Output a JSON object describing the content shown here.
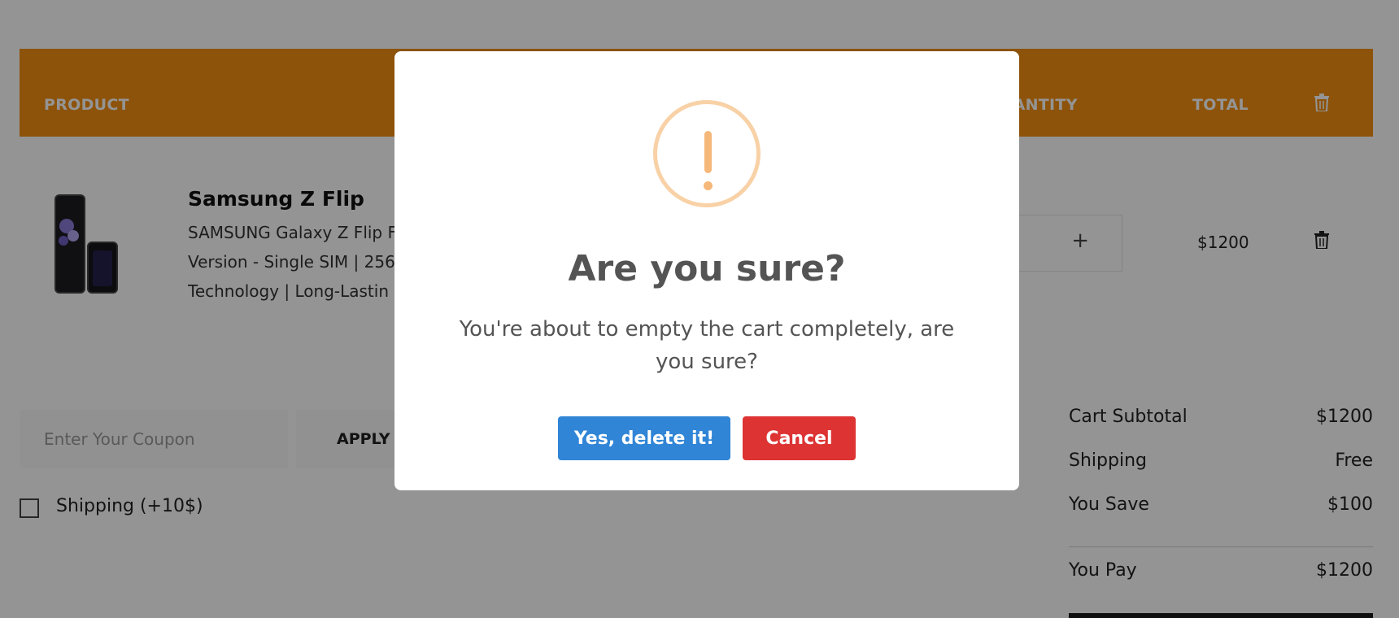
{
  "cart": {
    "headers": {
      "product": "PRODUCT",
      "quantity": "QUANTITY",
      "total": "TOTAL"
    },
    "items": [
      {
        "name": "Samsung Z Flip",
        "description": "SAMSUNG Galaxy Z Flip F\nVersion - Single SIM | 256\nTechnology | Long-Lastin",
        "total": "$1200"
      }
    ],
    "qty_plus": "+"
  },
  "coupon": {
    "placeholder": "Enter Your Coupon",
    "apply_label": "APPLY"
  },
  "shipping_option": {
    "label": "Shipping (+10$)"
  },
  "summary": {
    "subtotal_label": "Cart Subtotal",
    "subtotal_value": "$1200",
    "shipping_label": "Shipping",
    "shipping_value": "Free",
    "save_label": "You Save",
    "save_value": "$100",
    "pay_label": "You Pay",
    "pay_value": "$1200"
  },
  "dialog": {
    "icon": "warning-icon",
    "title": "Are you sure?",
    "text": "You're about to empty the cart completely, are you sure?",
    "confirm_label": "Yes, delete it!",
    "cancel_label": "Cancel"
  },
  "colors": {
    "header_accent": "#f39012",
    "confirm": "#3085d6",
    "cancel": "#dd3333",
    "warning": "#f6b77a"
  }
}
